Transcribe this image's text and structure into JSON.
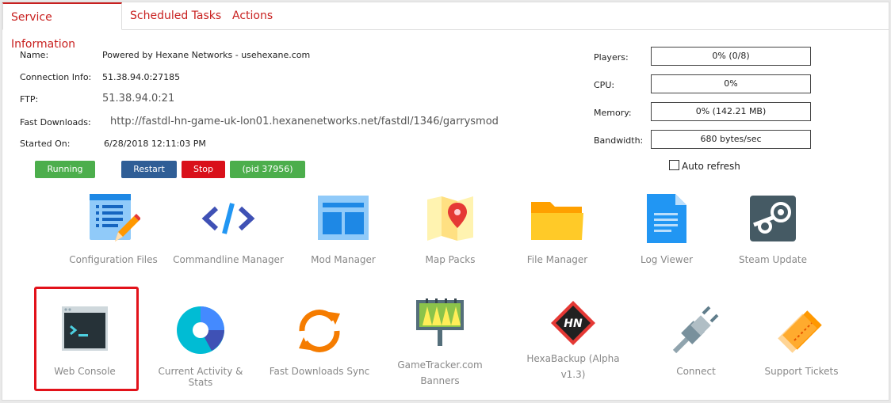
{
  "tabs": [
    "Service Information",
    "Scheduled Tasks",
    "Actions"
  ],
  "info": {
    "name_label": "Name:",
    "name_value": "Powered by Hexane Networks - usehexane.com",
    "conn_label": "Connection Info:",
    "conn_value": "51.38.94.0:27185",
    "ftp_label": "FTP:",
    "ftp_value": "51.38.94.0:21",
    "fastdl_label": "Fast Downloads:",
    "fastdl_value": "http://fastdl-hn-game-uk-lon01.hexanenetworks.net/fastdl/1346/garrysmod",
    "started_label": "Started On:",
    "started_value": "6/28/2018 12:11:03 PM"
  },
  "buttons": {
    "running": "Running",
    "restart": "Restart",
    "stop": "Stop",
    "pid": "(pid 37956)"
  },
  "stats": {
    "players_label": "Players:",
    "players_value": "0% (0/8)",
    "cpu_label": "CPU:",
    "cpu_value": "0%",
    "memory_label": "Memory:",
    "memory_value": "0% (142.21 MB)",
    "bandwidth_label": "Bandwidth:",
    "bandwidth_value": "680 bytes/sec",
    "auto_refresh": "Auto refresh"
  },
  "tools_row1": [
    {
      "label": "Configuration Files",
      "icon": "config-file-icon"
    },
    {
      "label": "Commandline Manager",
      "icon": "code-icon"
    },
    {
      "label": "Mod Manager",
      "icon": "layout-icon"
    },
    {
      "label": "Map Packs",
      "icon": "map-icon"
    },
    {
      "label": "File Manager",
      "icon": "folder-icon"
    },
    {
      "label": "Log Viewer",
      "icon": "document-icon"
    },
    {
      "label": "Steam Update",
      "icon": "steam-icon"
    }
  ],
  "tools_row2": [
    {
      "label": "Web Console",
      "icon": "terminal-icon"
    },
    {
      "label": "Current Activity & Stats",
      "icon": "pie-chart-icon"
    },
    {
      "label": "Fast Downloads Sync",
      "icon": "sync-icon"
    },
    {
      "label": "GameTracker.com Banners",
      "icon": "billboard-icon"
    },
    {
      "label": "HexaBackup (Alpha v1.3)",
      "icon": "hn-logo-icon",
      "logo_text": "HN"
    },
    {
      "label": "Connect",
      "icon": "plug-icon"
    },
    {
      "label": "Support Tickets",
      "icon": "ticket-icon"
    }
  ],
  "colors": {
    "accent": "#c8201f",
    "running": "#4cae4c",
    "restart": "#2f5e96",
    "stop": "#d9101a",
    "highlight": "#e2121a"
  }
}
